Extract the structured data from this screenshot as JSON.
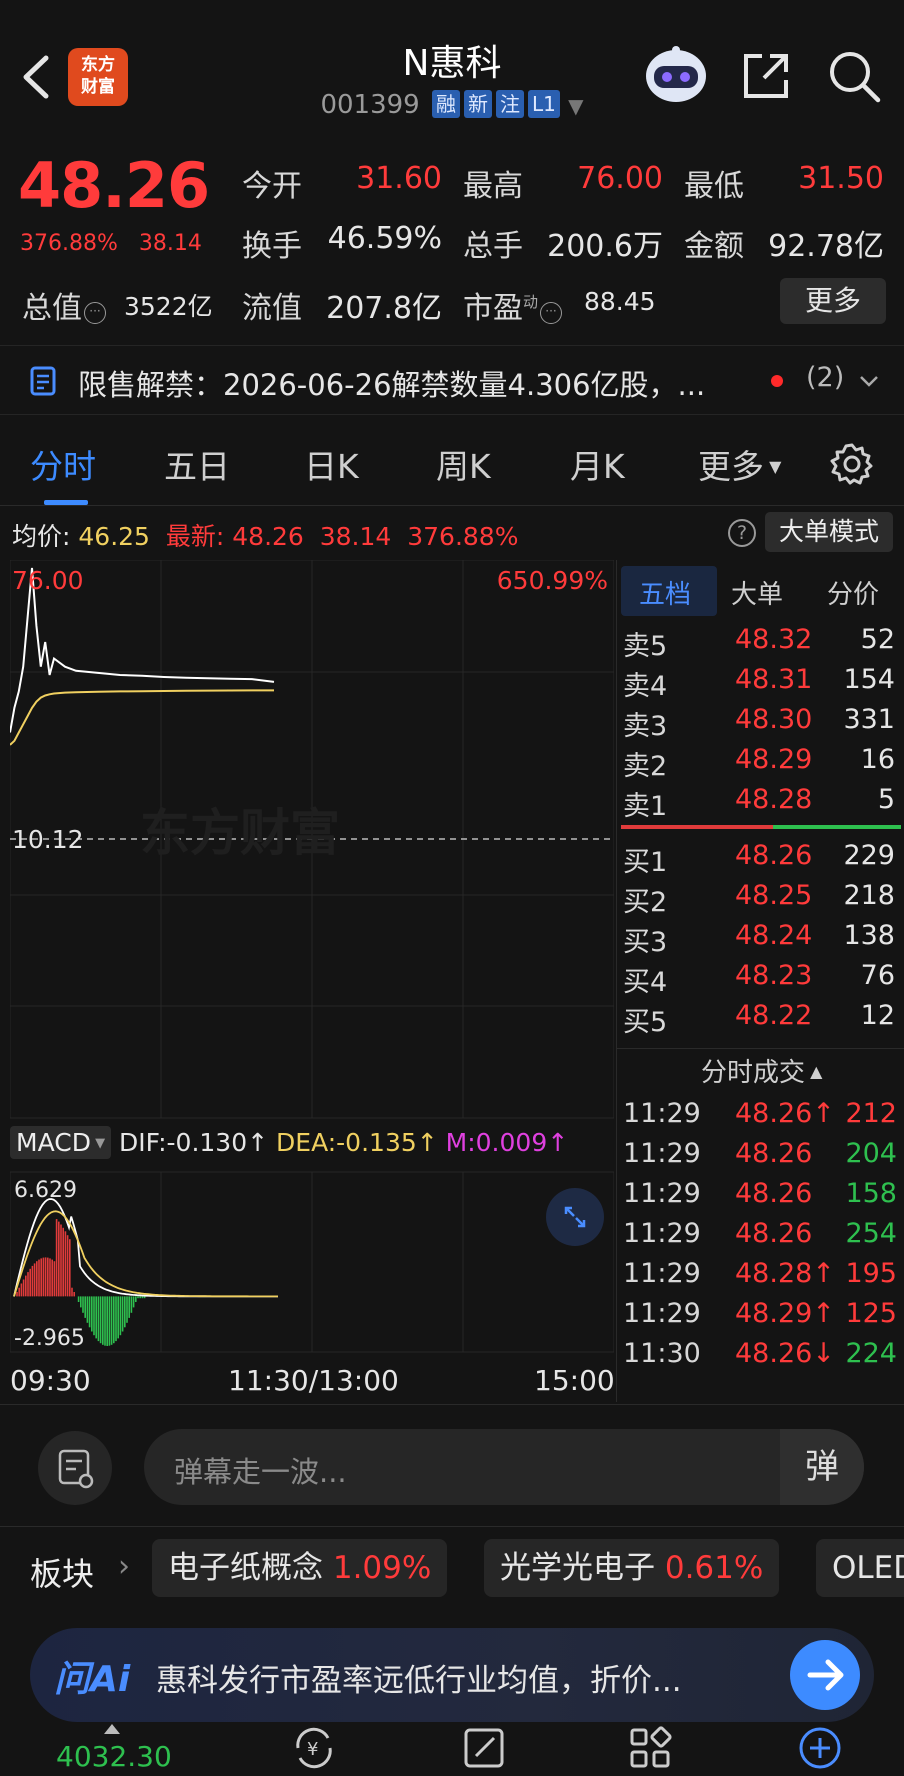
{
  "header": {
    "title": "N惠科",
    "code": "001399",
    "tags": [
      "融",
      "新",
      "注",
      "L1"
    ],
    "logo_line1": "东方",
    "logo_line2": "财富"
  },
  "quote": {
    "price": "48.26",
    "change_pct": "376.88%",
    "change_amt": "38.14",
    "fields": [
      {
        "label": "今开",
        "value": "31.60",
        "color": "#ff3b3b"
      },
      {
        "label": "最高",
        "value": "76.00",
        "color": "#ff3b3b"
      },
      {
        "label": "最低",
        "value": "31.50",
        "color": "#ff3b3b"
      },
      {
        "label": "换手",
        "value": "46.59%",
        "color": "#e6e6e6"
      },
      {
        "label": "总手",
        "value": "200.6万",
        "color": "#e6e6e6"
      },
      {
        "label": "金额",
        "value": "92.78亿",
        "color": "#e6e6e6"
      }
    ],
    "total_value_label": "总值",
    "total_value": "3522亿",
    "float_value_label": "流值",
    "float_value": "207.8亿",
    "pe_label": "市盈",
    "pe_sup": "动",
    "pe_value": "88.45",
    "more_label": "更多"
  },
  "notice": {
    "text": "限售解禁：2026-06-26解禁数量4.306亿股，...",
    "count": "(2)"
  },
  "tabs": [
    "分时",
    "五日",
    "日K",
    "周K",
    "月K",
    "更多"
  ],
  "info": {
    "avg_label": "均价:",
    "avg_value": "46.25",
    "latest_label": "最新:",
    "latest_price": "48.26",
    "latest_change": "38.14",
    "latest_pct": "376.88%",
    "help": "?",
    "mode_button": "大单模式"
  },
  "chart_data": [
    {
      "type": "line",
      "title": "",
      "y_top_label": "76.00",
      "y_top_pct": "650.99%",
      "y_mid_label": "10.12",
      "watermark": "东方财富",
      "series": [
        {
          "name": "最新",
          "color": "#ffffff",
          "x": [
            0,
            2,
            4,
            6,
            8,
            10,
            12,
            14,
            16,
            18,
            20,
            25,
            30,
            40,
            50,
            60,
            70,
            80,
            90,
            100,
            110,
            120
          ],
          "y": [
            36,
            42,
            46,
            52,
            64,
            76,
            62,
            52,
            58,
            50,
            54,
            52,
            51,
            50.5,
            50,
            49.8,
            49.5,
            49.3,
            49.2,
            49.1,
            49,
            48.3
          ]
        },
        {
          "name": "均价",
          "color": "#f0d060",
          "x": [
            0,
            2,
            4,
            6,
            8,
            10,
            12,
            14,
            16,
            18,
            20,
            25,
            30,
            40,
            50,
            60,
            70,
            80,
            90,
            100,
            110,
            120
          ],
          "y": [
            33,
            34,
            36,
            38,
            40,
            42,
            43.5,
            44.5,
            45,
            45.3,
            45.5,
            45.7,
            45.8,
            45.9,
            46,
            46.05,
            46.1,
            46.15,
            46.2,
            46.22,
            46.24,
            46.25
          ]
        }
      ]
    },
    {
      "type": "bar",
      "title": "MACD",
      "dropdown": "MACD",
      "dif_label": "DIF:-0.130↑",
      "dea_label": "DEA:-0.135↑",
      "m_label": "M:0.009↑",
      "ymax_label": "6.629",
      "ymin_label": "-2.965",
      "ylim": [
        -2.965,
        6.629
      ],
      "x_labels": [
        "09:30",
        "11:30/13:00",
        "15:00"
      ]
    }
  ],
  "order_book": {
    "tabs": [
      "五档",
      "大单",
      "分价"
    ],
    "asks": [
      {
        "label": "卖5",
        "price": "48.32",
        "volume": "52"
      },
      {
        "label": "卖4",
        "price": "48.31",
        "volume": "154"
      },
      {
        "label": "卖3",
        "price": "48.30",
        "volume": "331"
      },
      {
        "label": "卖2",
        "price": "48.29",
        "volume": "16"
      },
      {
        "label": "卖1",
        "price": "48.28",
        "volume": "5"
      }
    ],
    "bids": [
      {
        "label": "买1",
        "price": "48.26",
        "volume": "229"
      },
      {
        "label": "买2",
        "price": "48.25",
        "volume": "218"
      },
      {
        "label": "买3",
        "price": "48.24",
        "volume": "138"
      },
      {
        "label": "买4",
        "price": "48.23",
        "volume": "76"
      },
      {
        "label": "买5",
        "price": "48.22",
        "volume": "12"
      }
    ],
    "ticks_header": "分时成交",
    "ticks": [
      {
        "time": "11:29",
        "price": "48.26↑",
        "volume": "212",
        "vcolor": "#ff3b3b"
      },
      {
        "time": "11:29",
        "price": "48.26",
        "volume": "204",
        "vcolor": "#2ec04f"
      },
      {
        "time": "11:29",
        "price": "48.26",
        "volume": "158",
        "vcolor": "#2ec04f"
      },
      {
        "time": "11:29",
        "price": "48.26",
        "volume": "254",
        "vcolor": "#2ec04f"
      },
      {
        "time": "11:29",
        "price": "48.28↑",
        "volume": "195",
        "vcolor": "#ff3b3b"
      },
      {
        "time": "11:29",
        "price": "48.29↑",
        "volume": "125",
        "vcolor": "#ff3b3b"
      },
      {
        "time": "11:30",
        "price": "48.26↓",
        "volume": "224",
        "vcolor": "#2ec04f"
      }
    ]
  },
  "danmu": {
    "placeholder": "弹幕走一波...",
    "button": "弹"
  },
  "sectors": {
    "label": "板块",
    "chips": [
      {
        "name": "电子纸概念",
        "pct": "1.09%"
      },
      {
        "name": "光学光电子",
        "pct": "0.61%"
      },
      {
        "name": "OLED",
        "pct": ""
      }
    ]
  },
  "askai": {
    "logo": "问Ai",
    "text": "惠科发行市盈率远低行业均值，折价..."
  },
  "bottombar": {
    "index_value": "4032.30"
  }
}
